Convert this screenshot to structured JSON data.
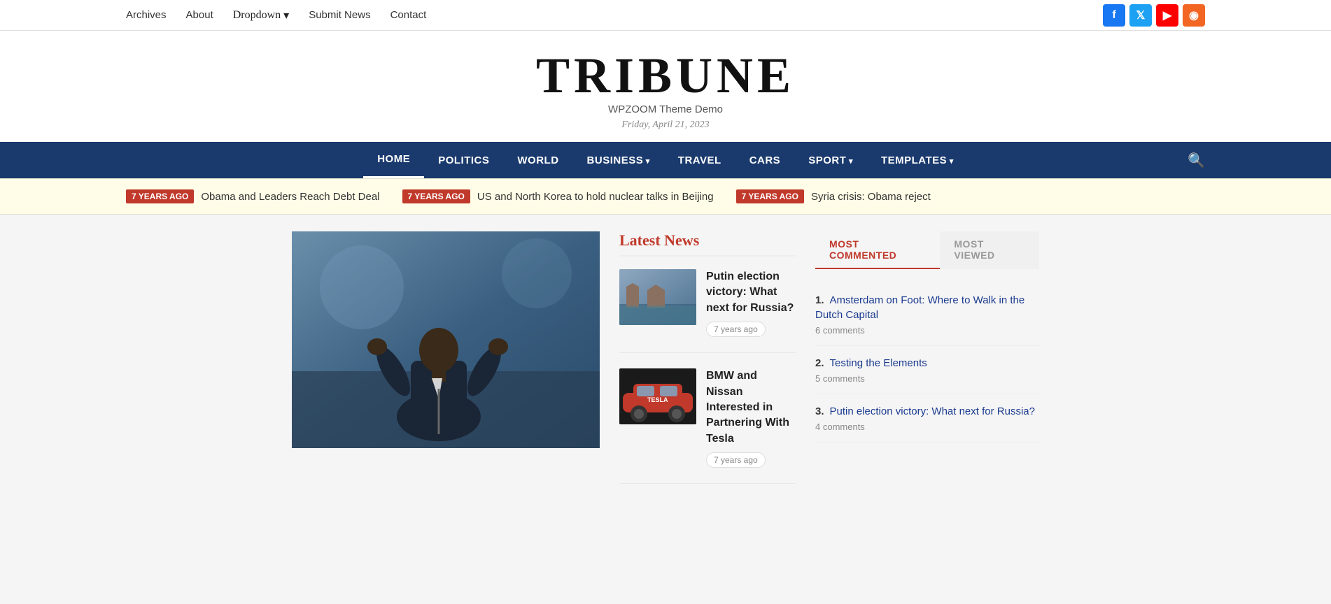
{
  "topnav": {
    "links": [
      {
        "label": "Archives",
        "href": "#"
      },
      {
        "label": "About",
        "href": "#"
      },
      {
        "label": "Dropdown",
        "href": "#",
        "hasDropdown": true
      },
      {
        "label": "Submit News",
        "href": "#"
      },
      {
        "label": "Contact",
        "href": "#"
      }
    ]
  },
  "social": [
    {
      "name": "facebook",
      "icon": "f",
      "class": "si-facebook"
    },
    {
      "name": "twitter",
      "icon": "t",
      "class": "si-twitter"
    },
    {
      "name": "youtube",
      "icon": "▶",
      "class": "si-youtube"
    },
    {
      "name": "rss",
      "icon": "◉",
      "class": "si-rss"
    }
  ],
  "header": {
    "logo": "TRIBUNE",
    "tagline": "WPZOOM Theme Demo",
    "date": "Friday, April 21, 2023"
  },
  "mainnav": {
    "items": [
      {
        "label": "HOME",
        "active": true,
        "hasDropdown": false
      },
      {
        "label": "POLITICS",
        "active": false,
        "hasDropdown": false
      },
      {
        "label": "WORLD",
        "active": false,
        "hasDropdown": false
      },
      {
        "label": "BUSINESS",
        "active": false,
        "hasDropdown": true
      },
      {
        "label": "TRAVEL",
        "active": false,
        "hasDropdown": false
      },
      {
        "label": "CARS",
        "active": false,
        "hasDropdown": false
      },
      {
        "label": "SPORT",
        "active": false,
        "hasDropdown": true
      },
      {
        "label": "TEMPLATES",
        "active": false,
        "hasDropdown": true
      }
    ]
  },
  "ticker": {
    "items": [
      {
        "badge": "7 YEARS AGO",
        "text": "Obama and Leaders Reach Debt Deal"
      },
      {
        "badge": "7 YEARS AGO",
        "text": "US and North Korea to hold nuclear talks in Beijing"
      },
      {
        "badge": "7 YEARS AGO",
        "text": "Syria crisis: Obama reject"
      }
    ]
  },
  "latestNews": {
    "title": "Latest News",
    "items": [
      {
        "title": "Putin election victory: What next for Russia?",
        "time": "7 years ago",
        "thumbColor": "#7a9ab8"
      },
      {
        "title": "BMW and Nissan Interested in Partnering With Tesla",
        "time": "7 years ago",
        "thumbColor": "#c0392b"
      }
    ]
  },
  "sidebar": {
    "tabs": [
      {
        "label": "MOST COMMENTED",
        "active": true
      },
      {
        "label": "MOST VIEWED",
        "active": false
      }
    ],
    "mostCommented": [
      {
        "num": "1.",
        "title": "Amsterdam on Foot: Where to Walk in the Dutch Capital",
        "comments": "6 comments"
      },
      {
        "num": "2.",
        "title": "Testing the Elements",
        "comments": "5 comments"
      },
      {
        "num": "3.",
        "title": "Putin election victory: What next for Russia?",
        "comments": "4 comments"
      }
    ]
  }
}
